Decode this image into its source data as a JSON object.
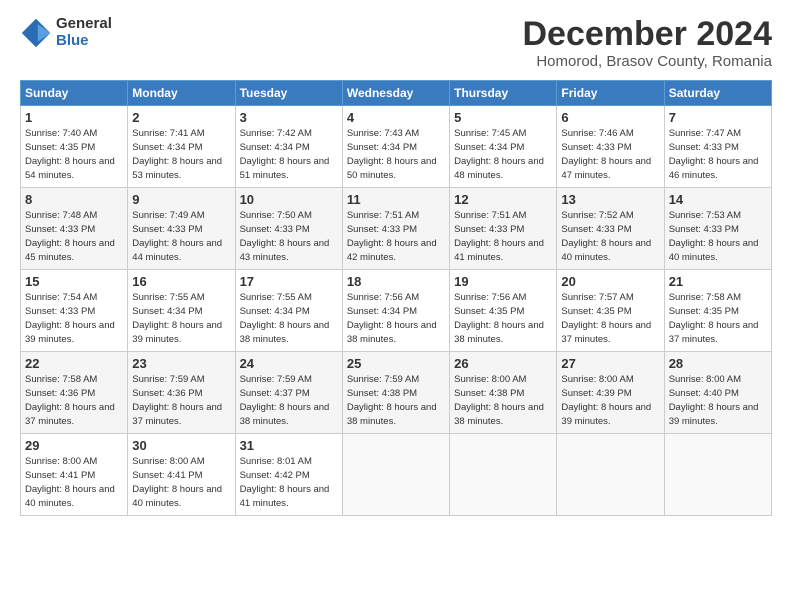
{
  "logo": {
    "general": "General",
    "blue": "Blue"
  },
  "title": "December 2024",
  "subtitle": "Homorod, Brasov County, Romania",
  "headers": [
    "Sunday",
    "Monday",
    "Tuesday",
    "Wednesday",
    "Thursday",
    "Friday",
    "Saturday"
  ],
  "weeks": [
    [
      {
        "day": "1",
        "sunrise": "7:40 AM",
        "sunset": "4:35 PM",
        "daylight": "8 hours and 54 minutes."
      },
      {
        "day": "2",
        "sunrise": "7:41 AM",
        "sunset": "4:34 PM",
        "daylight": "8 hours and 53 minutes."
      },
      {
        "day": "3",
        "sunrise": "7:42 AM",
        "sunset": "4:34 PM",
        "daylight": "8 hours and 51 minutes."
      },
      {
        "day": "4",
        "sunrise": "7:43 AM",
        "sunset": "4:34 PM",
        "daylight": "8 hours and 50 minutes."
      },
      {
        "day": "5",
        "sunrise": "7:45 AM",
        "sunset": "4:34 PM",
        "daylight": "8 hours and 48 minutes."
      },
      {
        "day": "6",
        "sunrise": "7:46 AM",
        "sunset": "4:33 PM",
        "daylight": "8 hours and 47 minutes."
      },
      {
        "day": "7",
        "sunrise": "7:47 AM",
        "sunset": "4:33 PM",
        "daylight": "8 hours and 46 minutes."
      }
    ],
    [
      {
        "day": "8",
        "sunrise": "7:48 AM",
        "sunset": "4:33 PM",
        "daylight": "8 hours and 45 minutes."
      },
      {
        "day": "9",
        "sunrise": "7:49 AM",
        "sunset": "4:33 PM",
        "daylight": "8 hours and 44 minutes."
      },
      {
        "day": "10",
        "sunrise": "7:50 AM",
        "sunset": "4:33 PM",
        "daylight": "8 hours and 43 minutes."
      },
      {
        "day": "11",
        "sunrise": "7:51 AM",
        "sunset": "4:33 PM",
        "daylight": "8 hours and 42 minutes."
      },
      {
        "day": "12",
        "sunrise": "7:51 AM",
        "sunset": "4:33 PM",
        "daylight": "8 hours and 41 minutes."
      },
      {
        "day": "13",
        "sunrise": "7:52 AM",
        "sunset": "4:33 PM",
        "daylight": "8 hours and 40 minutes."
      },
      {
        "day": "14",
        "sunrise": "7:53 AM",
        "sunset": "4:33 PM",
        "daylight": "8 hours and 40 minutes."
      }
    ],
    [
      {
        "day": "15",
        "sunrise": "7:54 AM",
        "sunset": "4:33 PM",
        "daylight": "8 hours and 39 minutes."
      },
      {
        "day": "16",
        "sunrise": "7:55 AM",
        "sunset": "4:34 PM",
        "daylight": "8 hours and 39 minutes."
      },
      {
        "day": "17",
        "sunrise": "7:55 AM",
        "sunset": "4:34 PM",
        "daylight": "8 hours and 38 minutes."
      },
      {
        "day": "18",
        "sunrise": "7:56 AM",
        "sunset": "4:34 PM",
        "daylight": "8 hours and 38 minutes."
      },
      {
        "day": "19",
        "sunrise": "7:56 AM",
        "sunset": "4:35 PM",
        "daylight": "8 hours and 38 minutes."
      },
      {
        "day": "20",
        "sunrise": "7:57 AM",
        "sunset": "4:35 PM",
        "daylight": "8 hours and 37 minutes."
      },
      {
        "day": "21",
        "sunrise": "7:58 AM",
        "sunset": "4:35 PM",
        "daylight": "8 hours and 37 minutes."
      }
    ],
    [
      {
        "day": "22",
        "sunrise": "7:58 AM",
        "sunset": "4:36 PM",
        "daylight": "8 hours and 37 minutes."
      },
      {
        "day": "23",
        "sunrise": "7:59 AM",
        "sunset": "4:36 PM",
        "daylight": "8 hours and 37 minutes."
      },
      {
        "day": "24",
        "sunrise": "7:59 AM",
        "sunset": "4:37 PM",
        "daylight": "8 hours and 38 minutes."
      },
      {
        "day": "25",
        "sunrise": "7:59 AM",
        "sunset": "4:38 PM",
        "daylight": "8 hours and 38 minutes."
      },
      {
        "day": "26",
        "sunrise": "8:00 AM",
        "sunset": "4:38 PM",
        "daylight": "8 hours and 38 minutes."
      },
      {
        "day": "27",
        "sunrise": "8:00 AM",
        "sunset": "4:39 PM",
        "daylight": "8 hours and 39 minutes."
      },
      {
        "day": "28",
        "sunrise": "8:00 AM",
        "sunset": "4:40 PM",
        "daylight": "8 hours and 39 minutes."
      }
    ],
    [
      {
        "day": "29",
        "sunrise": "8:00 AM",
        "sunset": "4:41 PM",
        "daylight": "8 hours and 40 minutes."
      },
      {
        "day": "30",
        "sunrise": "8:00 AM",
        "sunset": "4:41 PM",
        "daylight": "8 hours and 40 minutes."
      },
      {
        "day": "31",
        "sunrise": "8:01 AM",
        "sunset": "4:42 PM",
        "daylight": "8 hours and 41 minutes."
      },
      null,
      null,
      null,
      null
    ]
  ]
}
